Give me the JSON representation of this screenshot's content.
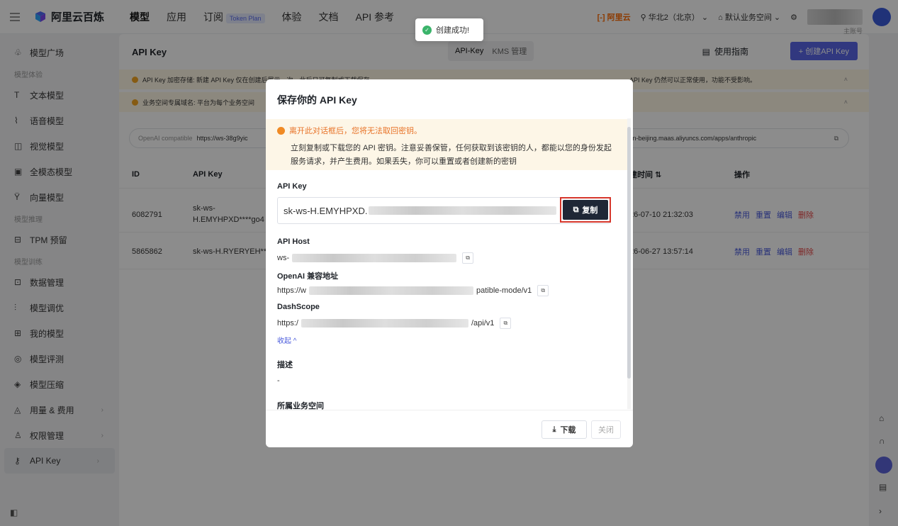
{
  "brand": {
    "name": "阿里云百炼"
  },
  "nav": [
    {
      "label": "模型",
      "active": true
    },
    {
      "label": "应用"
    },
    {
      "label": "订阅",
      "badge": "Token Plan"
    },
    {
      "label": "体验"
    },
    {
      "label": "文档"
    },
    {
      "label": "API 参考"
    }
  ],
  "topright": {
    "aliyun": "[-] 阿里云",
    "region": "华北2（北京）",
    "workspace": "默认业务空间",
    "account_role": "主账号"
  },
  "toast": {
    "text": "创建成功!"
  },
  "sidebar": {
    "items": [
      {
        "label": "模型广场",
        "icon": "model-square-icon"
      },
      {
        "group": "模型体验"
      },
      {
        "label": "文本模型",
        "icon": "text-icon"
      },
      {
        "label": "语音模型",
        "icon": "audio-icon"
      },
      {
        "label": "视觉模型",
        "icon": "camera-icon"
      },
      {
        "label": "全模态模型",
        "icon": "omni-icon"
      },
      {
        "label": "向量模型",
        "icon": "vector-icon"
      },
      {
        "group": "模型推理"
      },
      {
        "label": "TPM 预留",
        "icon": "tpm-icon"
      },
      {
        "group": "模型训练"
      },
      {
        "label": "数据管理",
        "icon": "data-icon"
      },
      {
        "label": "模型调优",
        "icon": "tune-icon"
      },
      {
        "label": "我的模型",
        "icon": "grid-icon"
      },
      {
        "label": "模型评测",
        "icon": "eval-icon"
      },
      {
        "label": "模型压缩",
        "icon": "compress-icon"
      },
      {
        "label": "用量 & 费用",
        "icon": "usage-icon",
        "arrow": true
      },
      {
        "label": "权限管理",
        "icon": "user-icon",
        "arrow": true
      },
      {
        "label": "API Key",
        "icon": "key-icon",
        "arrow": true,
        "selected": true
      }
    ]
  },
  "main": {
    "title": "API Key",
    "tabs": [
      "API-Key",
      "KMS 管理"
    ],
    "guide": "使用指南",
    "create_button": "+ 创建API Key",
    "notice1": "API Key 加密存储: 新建 API Key 仅在创建后展示一次，此后只可复制或下载保存。",
    "notice1_tail": "API Key 仍然可以正常使用，功能不受影响。",
    "notice2": "业务空间专属域名: 平台为每个业务空间",
    "url_label": "OpenAI compatible",
    "url_value": "https://ws-38g9yic",
    "url_right": "cn-beijing.maas.aliyuncs.com/apps/anthropic",
    "columns": [
      "ID",
      "API Key",
      "建时间 ⇅",
      "操作"
    ],
    "rows": [
      {
        "id": "6082791",
        "key1": "sk-ws-",
        "key2": "H.EMYHPXD****go4",
        "time": "26-07-10 21:32:03"
      },
      {
        "id": "5865862",
        "key1": "sk-ws-H.RYERYEH**",
        "key2": "",
        "time": "26-06-27 13:57:14"
      }
    ],
    "ops": [
      "禁用",
      "重置",
      "编辑",
      "删除"
    ]
  },
  "modal": {
    "title": "保存你的 API Key",
    "warn_title": "离开此对话框后，您将无法取回密钥。",
    "warn_body": "立刻复制或下载您的 API 密钥。注意妥善保管，任何获取到该密钥的人，都能以您的身份发起服务请求，并产生费用。如果丢失，你可以重置或者创建新的密钥",
    "api_key_label": "API Key",
    "api_key_value": "sk-ws-H.EMYHPXD.",
    "copy_label": "复制",
    "api_host_label": "API Host",
    "api_host_prefix": "ws-",
    "openai_label": "OpenAI 兼容地址",
    "openai_prefix": "https://w",
    "openai_suffix": "patible-mode/v1",
    "dashscope_label": "DashScope",
    "dashscope_prefix": "https:/",
    "dashscope_suffix": "/api/v1",
    "collapse": "收起 ^",
    "desc_label": "描述",
    "desc_value": "-",
    "workspace_label": "所属业务空间",
    "download": "下载",
    "close": "关闭"
  }
}
